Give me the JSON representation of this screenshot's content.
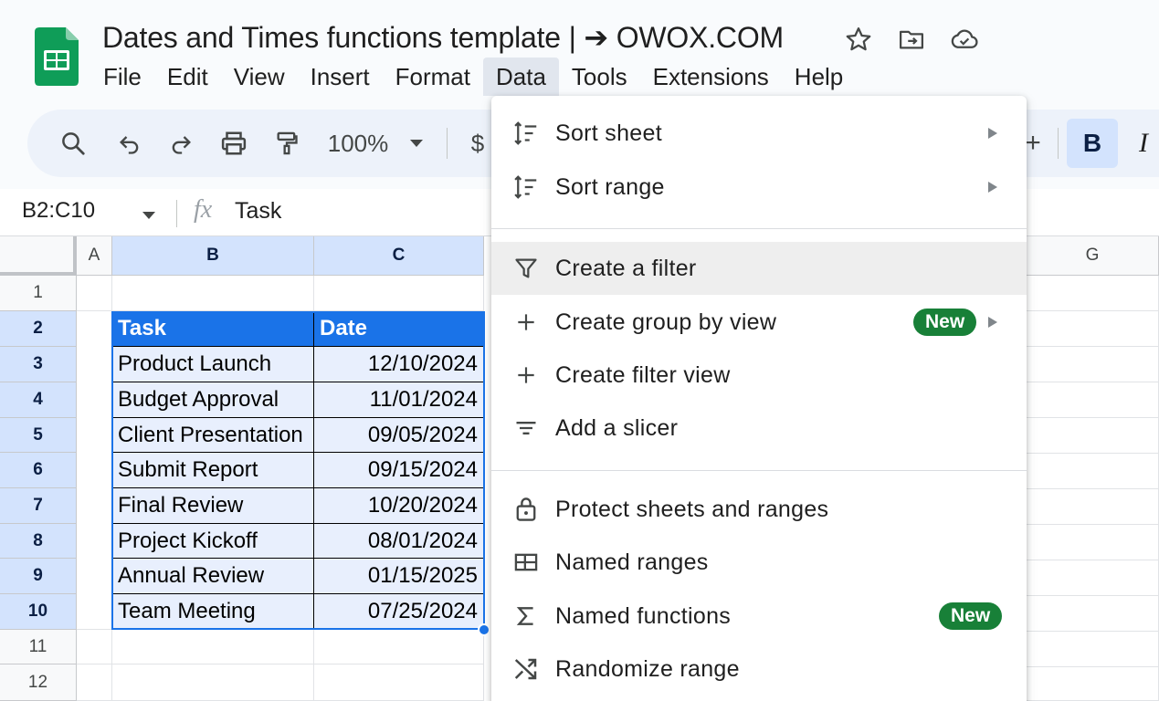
{
  "document": {
    "title": "Dates and Times functions template | ➔ OWOX.COM"
  },
  "menu": [
    "File",
    "Edit",
    "View",
    "Insert",
    "Format",
    "Data",
    "Tools",
    "Extensions",
    "Help"
  ],
  "toolbar": {
    "zoom": "100%",
    "currency": "$",
    "plus": "+",
    "bold": "B",
    "italic": "I"
  },
  "formula_bar": {
    "range": "B2:C10",
    "fx": "fx",
    "value": "Task"
  },
  "columns": [
    "A",
    "B",
    "C",
    "G"
  ],
  "rows": [
    "1",
    "2",
    "3",
    "4",
    "5",
    "6",
    "7",
    "8",
    "9",
    "10",
    "11",
    "12"
  ],
  "table": {
    "headers": [
      "Task",
      "Date"
    ],
    "rows": [
      [
        "Product Launch",
        "12/10/2024"
      ],
      [
        "Budget Approval",
        "11/01/2024"
      ],
      [
        "Client Presentation",
        "09/05/2024"
      ],
      [
        "Submit Report",
        "09/15/2024"
      ],
      [
        "Final Review",
        "10/20/2024"
      ],
      [
        "Project Kickoff",
        "08/01/2024"
      ],
      [
        "Annual Review",
        "01/15/2025"
      ],
      [
        "Team Meeting",
        "07/25/2024"
      ]
    ]
  },
  "data_menu": {
    "items": [
      {
        "label": "Sort sheet",
        "icon": "sort-icon",
        "submenu": true
      },
      {
        "label": "Sort range",
        "icon": "sort-icon",
        "submenu": true
      },
      {
        "label": "Create a filter",
        "icon": "filter-icon",
        "hover": true
      },
      {
        "label": "Create group by view",
        "icon": "plus-icon",
        "badge": "New",
        "submenu": true
      },
      {
        "label": "Create filter view",
        "icon": "plus-icon"
      },
      {
        "label": "Add a slicer",
        "icon": "slicer-icon"
      },
      {
        "label": "Protect sheets and ranges",
        "icon": "lock-icon"
      },
      {
        "label": "Named ranges",
        "icon": "named-range-icon"
      },
      {
        "label": "Named functions",
        "icon": "sigma-icon",
        "badge": "New"
      },
      {
        "label": "Randomize range",
        "icon": "shuffle-icon"
      }
    ]
  },
  "colors": {
    "accent": "#1a73e8",
    "selection": "#d3e3fd",
    "badge": "#188038",
    "sheets_green": "#0f9d58"
  }
}
